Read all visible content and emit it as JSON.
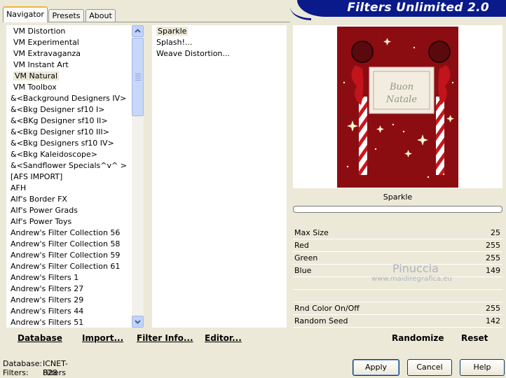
{
  "header": {
    "title": "Filters Unlimited 2.0"
  },
  "tabs": [
    {
      "label": "Navigator"
    },
    {
      "label": "Presets"
    },
    {
      "label": "About"
    }
  ],
  "categories": [
    "VM Distortion",
    "VM Experimental",
    "VM Extravaganza",
    "VM Instant Art",
    "VM Natural",
    "VM Toolbox",
    "&<Background Designers IV>",
    "&<Bkg Designer sf10 I>",
    "&<BKg Designer sf10 II>",
    "&<Bkg Designer sf10 III>",
    "&<Bkg Designers sf10 IV>",
    "&<Bkg Kaleidoscope>",
    "&<Sandflower Specials^v^ >",
    "[AFS IMPORT]",
    "AFH",
    "Alf's Border FX",
    "Alf's Power Grads",
    "Alf's Power Toys",
    "Andrew's Filter Collection 56",
    "Andrew's Filter Collection 58",
    "Andrew's Filter Collection 59",
    "Andrew's Filter Collection 61",
    "Andrew's Filters 1",
    "Andrew's Filters 27",
    "Andrew's Filters 29",
    "Andrew's Filters 44",
    "Andrew's Filters 51"
  ],
  "selected_category": "VM Natural",
  "filters": [
    "Sparkle",
    "Splash!...",
    "Weave Distortion..."
  ],
  "selected_filter": "Sparkle",
  "preview": {
    "filter_name": "Sparkle",
    "image_text_1": "Buon",
    "image_text_2": "Natale"
  },
  "params": [
    {
      "label": "Max Size",
      "value": "25"
    },
    {
      "label": "Red",
      "value": "255"
    },
    {
      "label": "Green",
      "value": "255"
    },
    {
      "label": "Blue",
      "value": "149"
    },
    {
      "label": "",
      "value": ""
    },
    {
      "label": "",
      "value": ""
    },
    {
      "label": "Rnd Color On/Off",
      "value": "255"
    },
    {
      "label": "Random Seed",
      "value": "142"
    }
  ],
  "watermark": {
    "name": "Pinuccia",
    "url": "www.maidiregrafica.eu"
  },
  "toolbar": {
    "database": "Database",
    "import": "Import...",
    "filter_info": "Filter Info...",
    "editor": "Editor...",
    "randomize": "Randomize",
    "reset": "Reset"
  },
  "status": {
    "database_label": "Database:",
    "database_value": "ICNET-Filters",
    "filters_label": "Filters:",
    "filters_value": "828"
  },
  "buttons": {
    "apply": "Apply",
    "cancel": "Cancel",
    "help": "Help"
  },
  "colors": {
    "banner": "#0a1a8a",
    "preview_red": "#8b0d12",
    "tab_accent": "#f3b53b"
  }
}
